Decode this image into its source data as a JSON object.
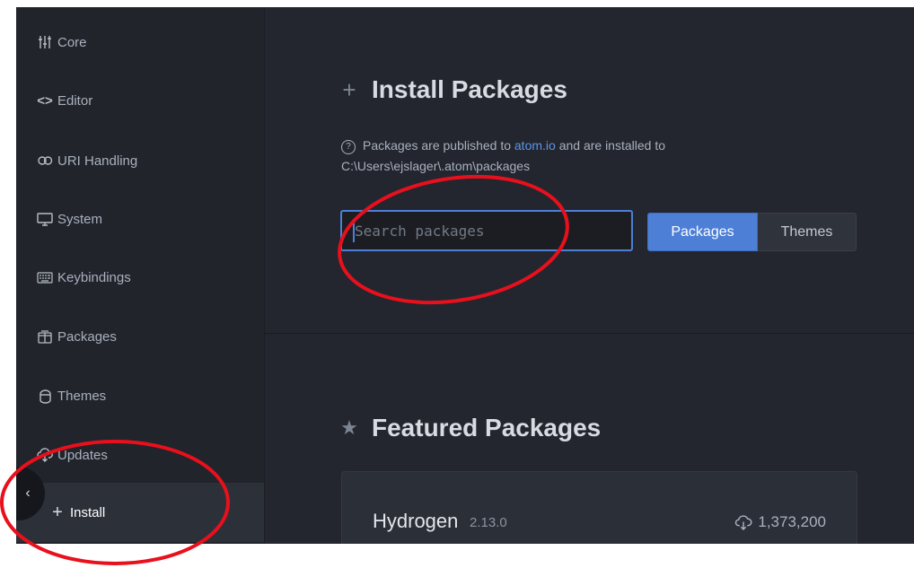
{
  "sidebar": {
    "items": [
      {
        "label": "Core",
        "icon": "sliders-icon"
      },
      {
        "label": "Editor",
        "icon": "code-icon"
      },
      {
        "label": "URI Handling",
        "icon": "link-icon"
      },
      {
        "label": "System",
        "icon": "monitor-icon"
      },
      {
        "label": "Keybindings",
        "icon": "keyboard-icon"
      },
      {
        "label": "Packages",
        "icon": "package-icon"
      },
      {
        "label": "Themes",
        "icon": "paintcan-icon"
      },
      {
        "label": "Updates",
        "icon": "cloud-download-icon"
      },
      {
        "label": "Install",
        "icon": "plus-icon",
        "active": true
      }
    ],
    "collapse_glyph": "‹"
  },
  "install": {
    "title": "Install Packages",
    "info_text_before": "Packages are published to ",
    "info_link": "atom.io",
    "info_text_after": " and are installed to",
    "info_path": "C:\\Users\\ejslager\\.atom\\packages",
    "search_placeholder": "Search packages",
    "toggle_packages": "Packages",
    "toggle_themes": "Themes"
  },
  "featured": {
    "title": "Featured Packages",
    "package": {
      "name": "Hydrogen",
      "version": "2.13.0",
      "downloads": "1,373,200"
    }
  },
  "colors": {
    "accent": "#4d7fd6",
    "annotation": "#e8101c",
    "background": "#23262e"
  }
}
